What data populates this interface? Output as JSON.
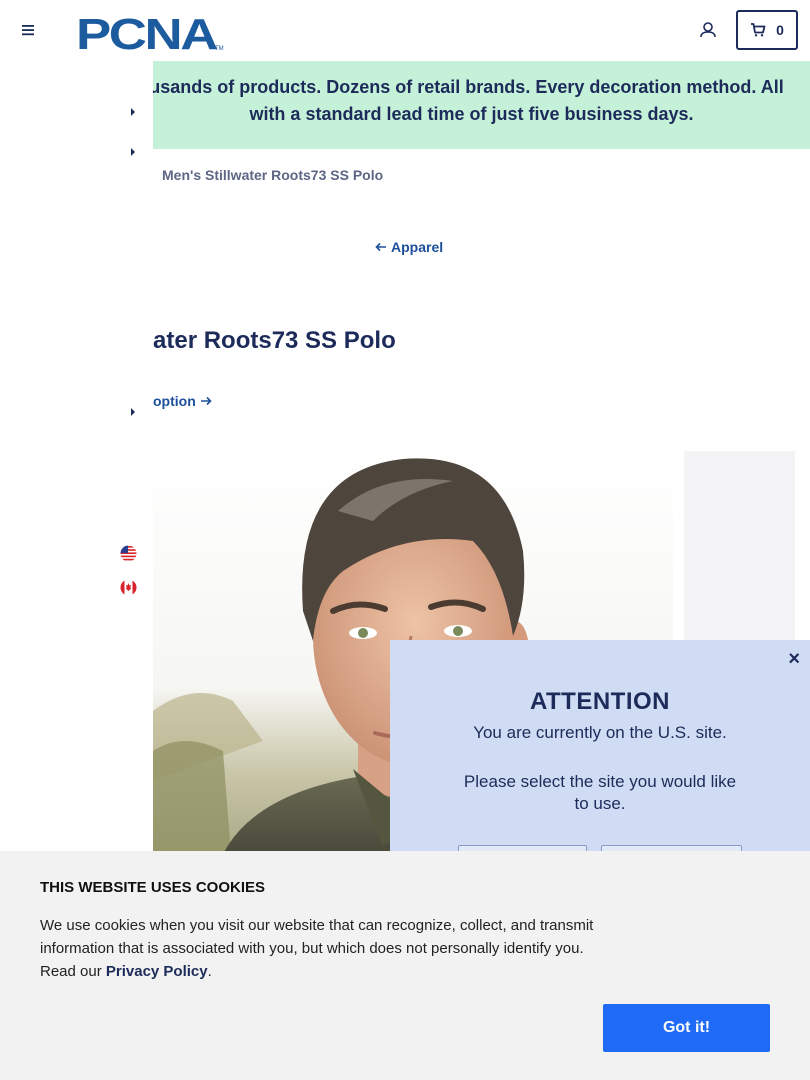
{
  "header": {
    "logo_text": "PCNA",
    "cart_count": "0",
    "brand_color": "#1c2b59"
  },
  "banner": {
    "line1": "usands of products. Dozens of retail brands. Every decoration method. All",
    "line2": "with a standard lead time of just five business days.",
    "background": "#c6f1d9"
  },
  "breadcrumb": "Men's Stillwater Roots73 SS Polo",
  "back_link": "Apparel",
  "product": {
    "title": "ater Roots73 SS Polo",
    "option_link": "option"
  },
  "modal": {
    "close": "×",
    "title": "ATTENTION",
    "line1": "You are currently on the U.S. site.",
    "line2": "Please select the site you would like to use."
  },
  "cookie": {
    "title": "THIS WEBSITE USES COOKIES",
    "text_before": "We use cookies when you visit our website that can recognize, collect, and transmit information that is associated with you, but which does not personally identify you. Read our ",
    "link": "Privacy Policy",
    "text_after": ".",
    "button": "Got it!",
    "button_color": "#1f6bf5"
  },
  "icons": [
    "menu-icon",
    "user-icon",
    "cart-icon",
    "chevron-right-icon",
    "us-flag-icon",
    "canada-flag-icon",
    "arrow-left-icon",
    "arrow-right-icon",
    "close-icon"
  ]
}
